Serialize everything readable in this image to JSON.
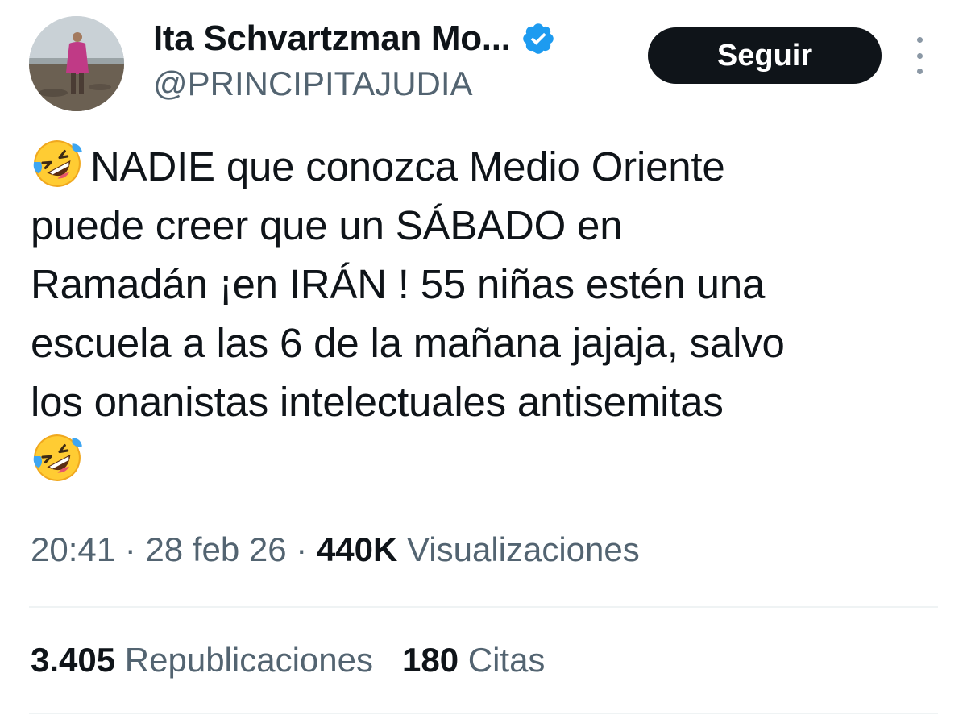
{
  "author": {
    "display_name": "Ita Schvartzman Mo...",
    "handle": "@PRINCIPITAJUDIA",
    "verified": true
  },
  "actions": {
    "follow_label": "Seguir"
  },
  "tweet": {
    "lines": [
      "NADIE  que conozca Medio Oriente",
      "puede creer que un SÁBADO en",
      "Ramadán ¡en IRÁN ! 55 niñas estén una",
      "escuela a las 6 de la mañana jajaja, salvo",
      "los onanistas intelectuales antisemitas"
    ],
    "emoji": "rolling-on-the-floor-laughing"
  },
  "meta": {
    "time": "20:41",
    "date": "28 feb 26",
    "views_count": "440K",
    "views_label": "Visualizaciones"
  },
  "stats": {
    "reposts_count": "3.405",
    "reposts_label": "Republicaciones",
    "quotes_count": "180",
    "quotes_label": "Citas"
  },
  "colors": {
    "text": "#0f1419",
    "secondary": "#536471",
    "verified_blue": "#1d9bf0",
    "button_bg": "#0f1419"
  }
}
